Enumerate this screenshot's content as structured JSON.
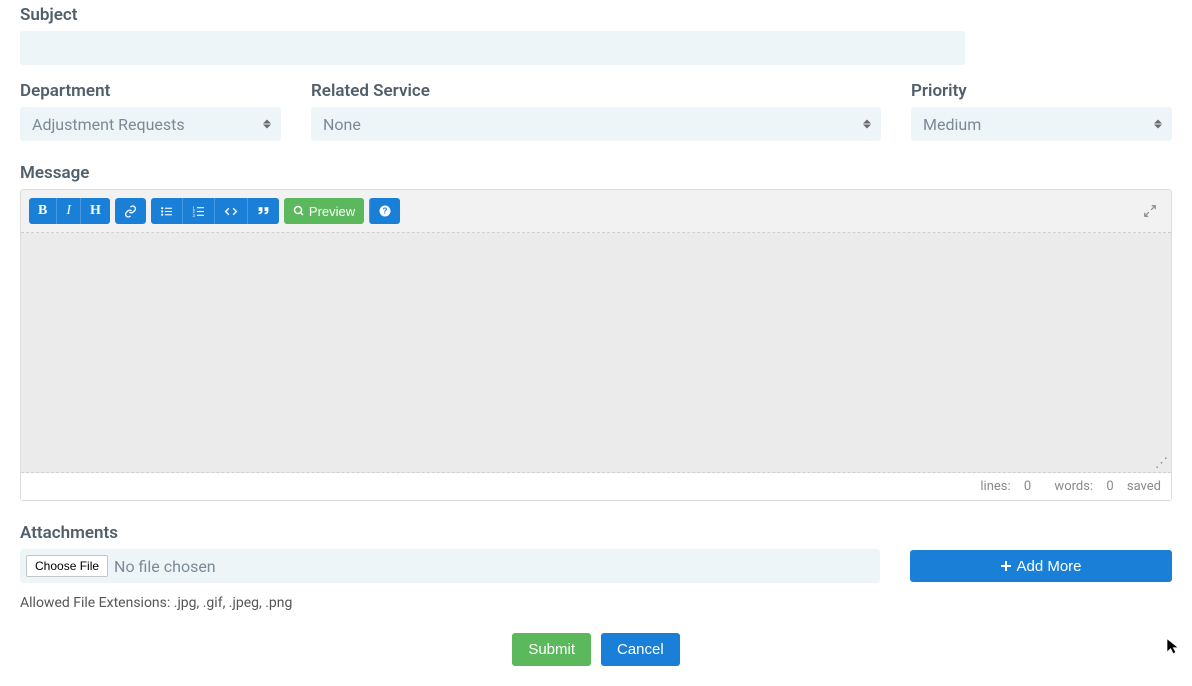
{
  "labels": {
    "subject": "Subject",
    "department": "Department",
    "related_service": "Related Service",
    "priority": "Priority",
    "message": "Message",
    "attachments": "Attachments"
  },
  "fields": {
    "subject_value": "",
    "department_selected": "Adjustment Requests",
    "related_service_selected": "None",
    "priority_selected": "Medium"
  },
  "editor": {
    "preview_label": "Preview",
    "status": {
      "lines_label": "lines:",
      "lines_value": "0",
      "words_label": "words:",
      "words_value": "0",
      "saved": "saved"
    }
  },
  "attachments": {
    "choose_file_label": "Choose File",
    "no_file": "No file chosen",
    "add_more": "Add More",
    "hint": "Allowed File Extensions: .jpg, .gif, .jpeg, .png"
  },
  "actions": {
    "submit": "Submit",
    "cancel": "Cancel"
  }
}
